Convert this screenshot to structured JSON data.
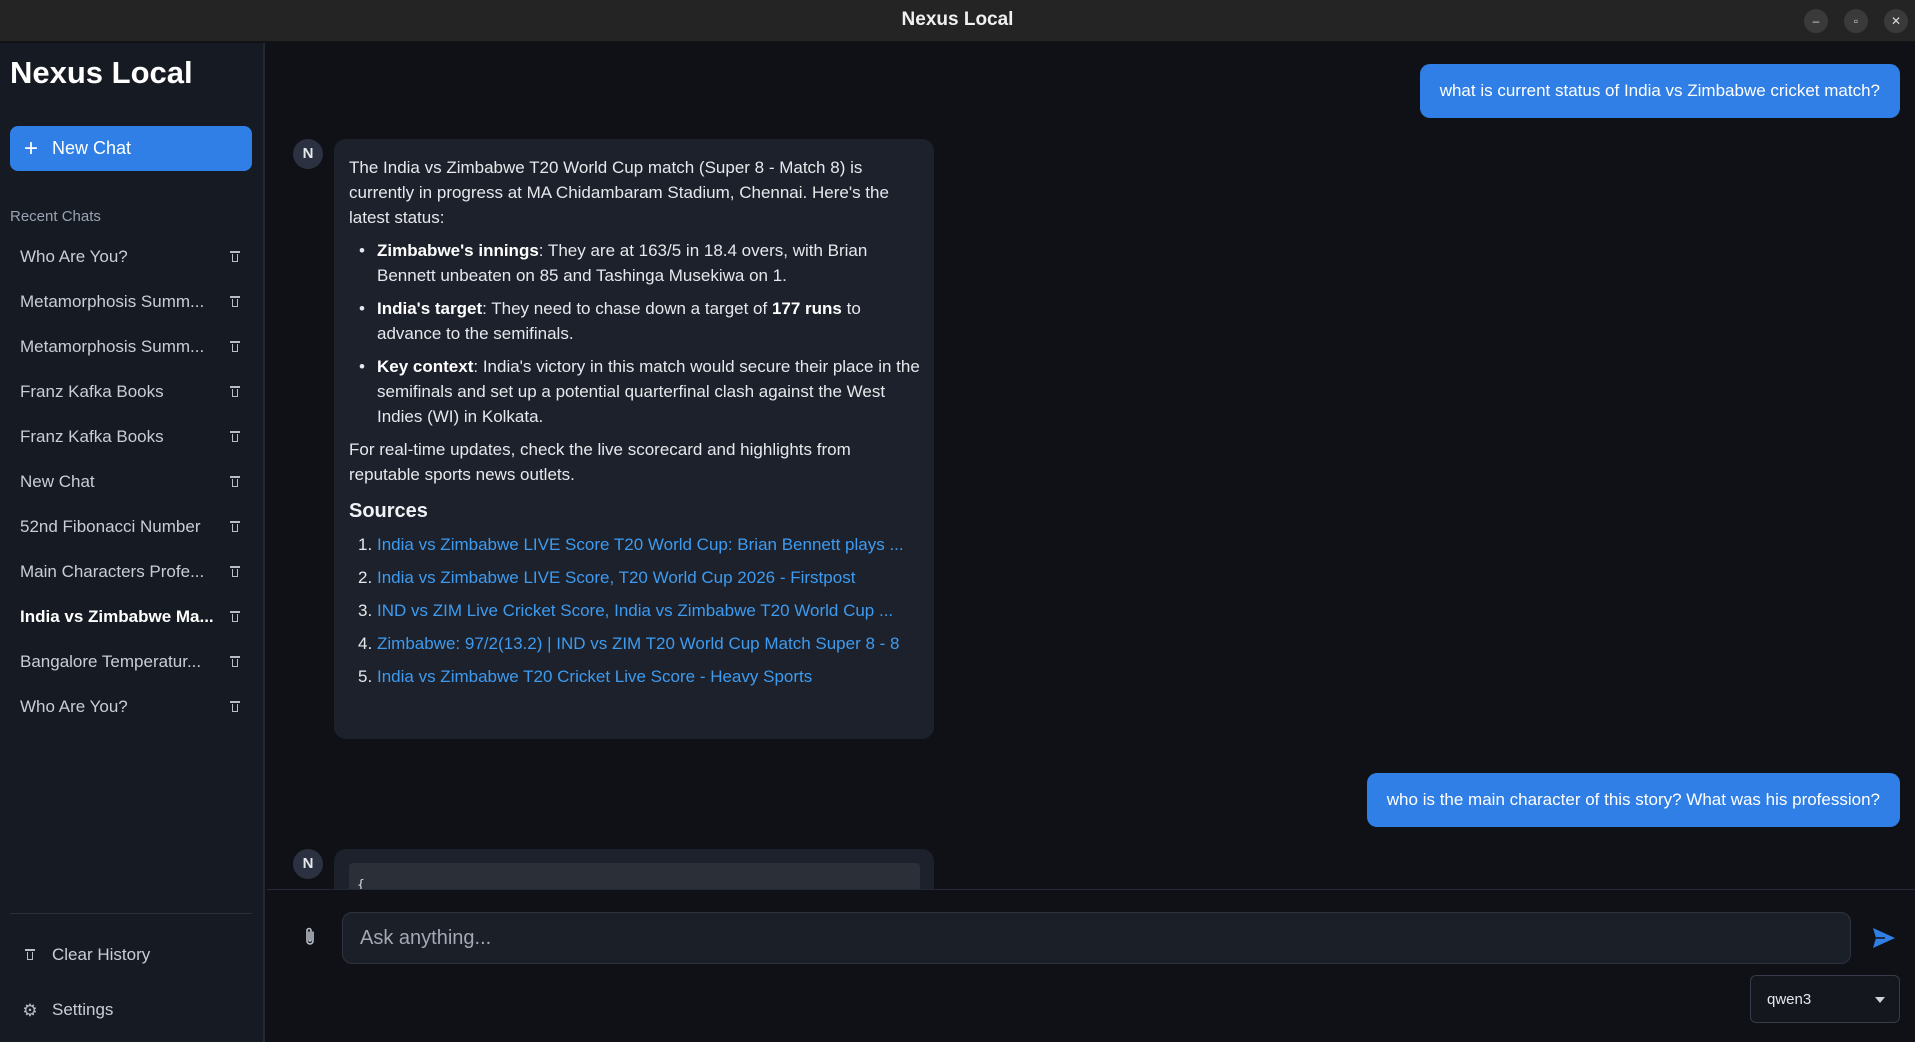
{
  "window": {
    "title": "Nexus Local",
    "controls": {
      "minimize": "–",
      "maximize": "▫",
      "close": "✕"
    }
  },
  "sidebar": {
    "brand": "Nexus Local",
    "new_chat_label": "New Chat",
    "recent_label": "Recent Chats",
    "items": [
      {
        "label": "Who Are You?",
        "active": false
      },
      {
        "label": "Metamorphosis Summ...",
        "active": false
      },
      {
        "label": "Metamorphosis Summ...",
        "active": false
      },
      {
        "label": "Franz Kafka Books",
        "active": false
      },
      {
        "label": "Franz Kafka Books",
        "active": false
      },
      {
        "label": "New Chat",
        "active": false
      },
      {
        "label": "52nd Fibonacci Number",
        "active": false
      },
      {
        "label": "Main Characters Profe...",
        "active": false
      },
      {
        "label": "India vs Zimbabwe Ma...",
        "active": true
      },
      {
        "label": "Bangalore Temperatur...",
        "active": false
      },
      {
        "label": "Who Are You?",
        "active": false
      }
    ],
    "clear_history_label": "Clear History",
    "settings_label": "Settings"
  },
  "conversation": {
    "user_q1": "what is current status of India vs Zimbabwe cricket match?",
    "avatar_letter": "N",
    "answer1": {
      "intro": "The India vs Zimbabwe T20 World Cup match (Super 8 - Match 8) is currently in progress at MA Chidambaram Stadium, Chennai. Here's the latest status:",
      "bullets": [
        {
          "bold": "Zimbabwe's innings",
          "text": ": They are at 163/5 in 18.4 overs, with Brian Bennett unbeaten on 85 and Tashinga Musekiwa on 1."
        },
        {
          "bold": "India's target",
          "text_a": ": They need to chase down a target of ",
          "bold2": "177 runs",
          "text_b": " to advance to the semifinals."
        },
        {
          "bold": "Key context",
          "text": ": India's victory in this match would secure their place in the semifinals and set up a potential quarterfinal clash against the West Indies (WI) in Kolkata."
        }
      ],
      "outro": "For real-time updates, check the live scorecard and highlights from reputable sports news outlets.",
      "sources_heading": "Sources",
      "sources": [
        {
          "num": "1.",
          "text": "India vs Zimbabwe LIVE Score T20 World Cup: Brian Bennett plays ..."
        },
        {
          "num": "2.",
          "text": "India vs Zimbabwe LIVE Score, T20 World Cup 2026 - Firstpost"
        },
        {
          "num": "3.",
          "text": "IND vs ZIM Live Cricket Score, India vs Zimbabwe T20 World Cup ..."
        },
        {
          "num": "4.",
          "text": "Zimbabwe: 97/2(13.2) | IND vs ZIM T20 World Cup Match Super 8 - 8"
        },
        {
          "num": "5.",
          "text": "India vs Zimbabwe T20 Cricket Live Score - Heavy Sports"
        }
      ]
    },
    "user_q2": "who is the main character of this story? What was his profession?",
    "answer2_code": "{"
  },
  "composer": {
    "placeholder": "Ask anything...",
    "value": "",
    "model": "qwen3"
  },
  "colors": {
    "accent": "#2f7fe6",
    "link": "#3e9bf0",
    "background": "#0f1117",
    "sidebar": "#161a22",
    "bubble": "#1c212b"
  },
  "icons": {
    "new_chat": "plus-icon",
    "delete": "trash-icon",
    "clear_history": "trash-icon",
    "settings": "gear-icon",
    "attach": "paperclip-icon",
    "send": "send-icon",
    "model_dropdown": "caret-down-icon"
  }
}
